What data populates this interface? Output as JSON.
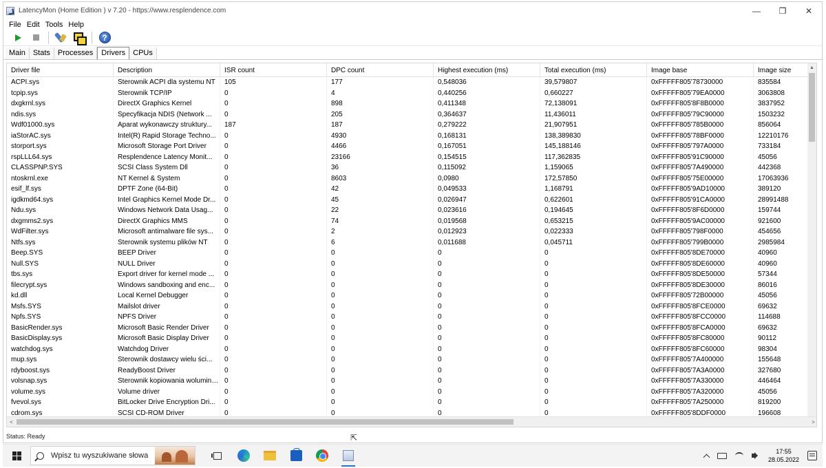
{
  "window": {
    "title": "LatencyMon  (Home Edition )  v 7.20 - https://www.resplendence.com",
    "minimize": "—",
    "maximize": "❐",
    "close": "✕"
  },
  "menu": [
    "File",
    "Edit",
    "Tools",
    "Help"
  ],
  "toolbar": {
    "icons": [
      "play-icon",
      "stop-icon",
      "tools-icon",
      "windows-icon",
      "help-icon"
    ],
    "help_glyph": "?"
  },
  "tabs": [
    {
      "label": "Main",
      "active": false
    },
    {
      "label": "Stats",
      "active": false
    },
    {
      "label": "Processes",
      "active": false
    },
    {
      "label": "Drivers",
      "active": true
    },
    {
      "label": "CPUs",
      "active": false
    }
  ],
  "table": {
    "columns": [
      "Driver file",
      "Description",
      "ISR count",
      "DPC count",
      "Highest execution (ms)",
      "Total execution (ms)",
      "Image base",
      "Image size"
    ],
    "rows": [
      [
        "ACPI.sys",
        "Sterownik ACPI dla systemu NT",
        "105",
        "177",
        "0,548036",
        "39,579807",
        "0xFFFFF805'78730000",
        "835584"
      ],
      [
        "tcpip.sys",
        "Sterownik TCP/IP",
        "0",
        "4",
        "0,440256",
        "0,660227",
        "0xFFFFF805'79EA0000",
        "3063808"
      ],
      [
        "dxgkrnl.sys",
        "DirectX Graphics Kernel",
        "0",
        "898",
        "0,411348",
        "72,138091",
        "0xFFFFF805'8F8B0000",
        "3837952"
      ],
      [
        "ndis.sys",
        "Specyfikacja NDIS (Network ...",
        "0",
        "205",
        "0,364637",
        "11,436011",
        "0xFFFFF805'79C90000",
        "1503232"
      ],
      [
        "Wdf01000.sys",
        "Aparat wykonawczy struktury...",
        "187",
        "187",
        "0,279222",
        "21,907951",
        "0xFFFFF805'785B0000",
        "856064"
      ],
      [
        "iaStorAC.sys",
        "Intel(R) Rapid Storage Techno...",
        "0",
        "4930",
        "0,168131",
        "138,389830",
        "0xFFFFF805'78BF0000",
        "12210176"
      ],
      [
        "storport.sys",
        "Microsoft Storage Port Driver",
        "0",
        "4466",
        "0,167051",
        "145,188146",
        "0xFFFFF805'797A0000",
        "733184"
      ],
      [
        "rspLLL64.sys",
        "Resplendence Latency Monit...",
        "0",
        "23166",
        "0,154515",
        "117,362835",
        "0xFFFFF805'91C90000",
        "45056"
      ],
      [
        "CLASSPNP.SYS",
        "SCSI Class System Dll",
        "0",
        "36",
        "0,115092",
        "1,159065",
        "0xFFFFF805'7A490000",
        "442368"
      ],
      [
        "ntoskrnl.exe",
        "NT Kernel & System",
        "0",
        "8603",
        "0,0980",
        "172,57850",
        "0xFFFFF805'75E00000",
        "17063936"
      ],
      [
        "esif_lf.sys",
        "DPTF Zone (64-Bit)",
        "0",
        "42",
        "0,049533",
        "1,168791",
        "0xFFFFF805'9AD10000",
        "389120"
      ],
      [
        "igdkmd64.sys",
        "Intel Graphics Kernel Mode Dr...",
        "0",
        "45",
        "0,026947",
        "0,622601",
        "0xFFFFF805'91CA0000",
        "28991488"
      ],
      [
        "Ndu.sys",
        "Windows Network Data Usag...",
        "0",
        "22",
        "0,023616",
        "0,194645",
        "0xFFFFF805'8F6D0000",
        "159744"
      ],
      [
        "dxgmms2.sys",
        "DirectX Graphics MMS",
        "0",
        "74",
        "0,019568",
        "0,653215",
        "0xFFFFF805'9AC00000",
        "921600"
      ],
      [
        "WdFilter.sys",
        "Microsoft antimalware file sys...",
        "0",
        "2",
        "0,012923",
        "0,022333",
        "0xFFFFF805'798F0000",
        "454656"
      ],
      [
        "Ntfs.sys",
        "Sterownik systemu plików NT",
        "0",
        "6",
        "0,011688",
        "0,045711",
        "0xFFFFF805'799B0000",
        "2985984"
      ],
      [
        "Beep.SYS",
        "BEEP Driver",
        "0",
        "0",
        "0",
        "0",
        "0xFFFFF805'8DE70000",
        "40960"
      ],
      [
        "Null.SYS",
        "NULL Driver",
        "0",
        "0",
        "0",
        "0",
        "0xFFFFF805'8DE60000",
        "40960"
      ],
      [
        "tbs.sys",
        "Export driver for kernel mode ...",
        "0",
        "0",
        "0",
        "0",
        "0xFFFFF805'8DE50000",
        "57344"
      ],
      [
        "filecrypt.sys",
        "Windows sandboxing and enc...",
        "0",
        "0",
        "0",
        "0",
        "0xFFFFF805'8DE30000",
        "86016"
      ],
      [
        "kd.dll",
        "Local Kernel Debugger",
        "0",
        "0",
        "0",
        "0",
        "0xFFFFF805'72B00000",
        "45056"
      ],
      [
        "Msfs.SYS",
        "Mailslot driver",
        "0",
        "0",
        "0",
        "0",
        "0xFFFFF805'8FCE0000",
        "69632"
      ],
      [
        "Npfs.SYS",
        "NPFS Driver",
        "0",
        "0",
        "0",
        "0",
        "0xFFFFF805'8FCC0000",
        "114688"
      ],
      [
        "BasicRender.sys",
        "Microsoft Basic Render Driver",
        "0",
        "0",
        "0",
        "0",
        "0xFFFFF805'8FCA0000",
        "69632"
      ],
      [
        "BasicDisplay.sys",
        "Microsoft Basic Display Driver",
        "0",
        "0",
        "0",
        "0",
        "0xFFFFF805'8FC80000",
        "90112"
      ],
      [
        "watchdog.sys",
        "Watchdog Driver",
        "0",
        "0",
        "0",
        "0",
        "0xFFFFF805'8FC60000",
        "98304"
      ],
      [
        "mup.sys",
        "Sterownik dostawcy wielu ści...",
        "0",
        "0",
        "0",
        "0",
        "0xFFFFF805'7A400000",
        "155648"
      ],
      [
        "rdyboost.sys",
        "ReadyBoost Driver",
        "0",
        "0",
        "0",
        "0",
        "0xFFFFF805'7A3A0000",
        "327680"
      ],
      [
        "volsnap.sys",
        "Sterownik kopiowania woluminu...",
        "0",
        "0",
        "0",
        "0",
        "0xFFFFF805'7A330000",
        "446464"
      ],
      [
        "volume.sys",
        "Volume driver",
        "0",
        "0",
        "0",
        "0",
        "0xFFFFF805'7A320000",
        "45056"
      ],
      [
        "fvevol.sys",
        "BitLocker Drive Encryption Dri...",
        "0",
        "0",
        "0",
        "0",
        "0xFFFFF805'7A250000",
        "819200"
      ],
      [
        "cdrom.sys",
        "SCSI CD-ROM Driver",
        "0",
        "0",
        "0",
        "0",
        "0xFFFFF805'8DDF0000",
        "196608"
      ]
    ]
  },
  "scroll": {
    "up": "▲",
    "down": "▼",
    "left": "<",
    "right": ">"
  },
  "status": "Status: Ready",
  "taskbar": {
    "search_placeholder": "Wpisz tu wyszukiwane słowa",
    "time": "17:55",
    "date": "28.05.2022"
  }
}
